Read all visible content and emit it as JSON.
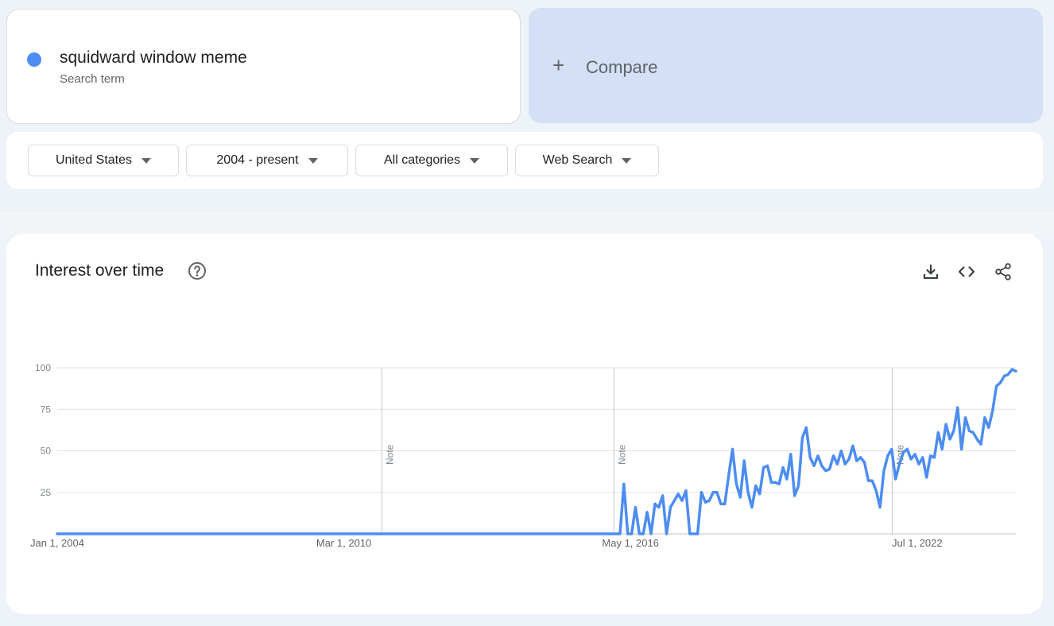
{
  "search_term": {
    "name": "squidward window meme",
    "subtitle": "Search term",
    "color": "#4d8df2"
  },
  "compare": {
    "plus": "+",
    "label": "Compare"
  },
  "filters": [
    {
      "label": "United States"
    },
    {
      "label": "2004 - present"
    },
    {
      "label": "All categories"
    },
    {
      "label": "Web Search"
    }
  ],
  "chart_card": {
    "title": "Interest over time",
    "icons": [
      "help-icon",
      "download-icon",
      "embed-code-icon",
      "share-icon"
    ]
  },
  "chart_data": {
    "type": "line",
    "title": "Interest over time",
    "xlabel": "",
    "ylabel": "",
    "ylim": [
      0,
      100
    ],
    "yticks": [
      "100",
      "75",
      "50",
      "25"
    ],
    "xticks": [
      "Jan 1, 2004",
      "Mar 1, 2010",
      "May 1, 2016",
      "Jul 1, 2022"
    ],
    "xrange": [
      "2004-01",
      "2024-09"
    ],
    "notes": [
      {
        "label": "Note",
        "x": "2011-01"
      },
      {
        "label": "Note",
        "x": "2016-01"
      },
      {
        "label": "Note",
        "x": "2022-01"
      }
    ],
    "grid": true,
    "legend": "none",
    "line_color": "#4d8df2",
    "series": [
      {
        "values": [
          0,
          0,
          0,
          0,
          0,
          0,
          0,
          0,
          0,
          0,
          0,
          0,
          0,
          0,
          0,
          0,
          0,
          0,
          0,
          0,
          0,
          0,
          0,
          0,
          0,
          0,
          0,
          0,
          0,
          0,
          0,
          0,
          0,
          0,
          0,
          0,
          0,
          0,
          0,
          0,
          0,
          0,
          0,
          0,
          0,
          0,
          0,
          0,
          0,
          0,
          0,
          0,
          0,
          0,
          0,
          0,
          0,
          0,
          0,
          0,
          0,
          0,
          0,
          0,
          0,
          0,
          0,
          0,
          0,
          0,
          0,
          0,
          0,
          0,
          0,
          0,
          0,
          0,
          0,
          0,
          0,
          0,
          0,
          0,
          0,
          0,
          0,
          0,
          0,
          0,
          0,
          0,
          0,
          0,
          0,
          0,
          0,
          0,
          0,
          0,
          0,
          0,
          0,
          0,
          0,
          0,
          0,
          0,
          0,
          0,
          0,
          0,
          0,
          0,
          0,
          0,
          0,
          0,
          0,
          0,
          0,
          0,
          0,
          0,
          0,
          0,
          0,
          0,
          0,
          0,
          0,
          0,
          0,
          0,
          0,
          0,
          0,
          0,
          0,
          0,
          0,
          0,
          0,
          0,
          0,
          0,
          30,
          0,
          0,
          16,
          0,
          0,
          13,
          0,
          18,
          16,
          23,
          0,
          16,
          20,
          24,
          20,
          26,
          0,
          0,
          0,
          25,
          19,
          20,
          25,
          25,
          18,
          18,
          35,
          51,
          30,
          22,
          44,
          25,
          16,
          29,
          24,
          40,
          41,
          31,
          31,
          30,
          40,
          33,
          48,
          23,
          29,
          58,
          64,
          46,
          41,
          47,
          41,
          38,
          39,
          47,
          42,
          50,
          42,
          45,
          53,
          44,
          46,
          43,
          32,
          32,
          26,
          16,
          38,
          47,
          51,
          33,
          42,
          49,
          51,
          45,
          48,
          42,
          46,
          34,
          47,
          46,
          61,
          51,
          66,
          57,
          62,
          76,
          51,
          70,
          62,
          61,
          57,
          54,
          70,
          64,
          74,
          89,
          91,
          95,
          96,
          99,
          98
        ]
      }
    ]
  }
}
